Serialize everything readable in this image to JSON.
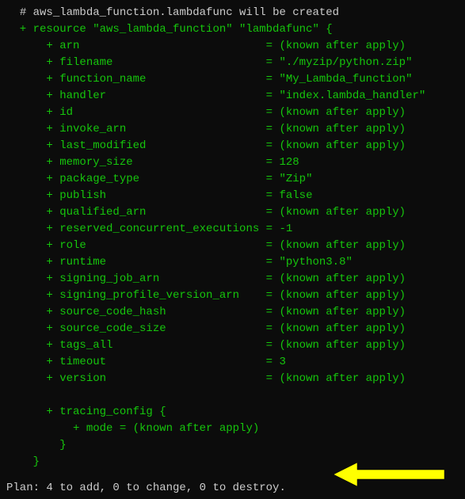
{
  "header_comment": "# aws_lambda_function.lambdafunc will be created",
  "resource_line": "  + resource \"aws_lambda_function\" \"lambdafunc\" {",
  "attrs": [
    {
      "key": "      + arn                            ",
      "val": "= (known after apply)"
    },
    {
      "key": "      + filename                       ",
      "val": "= \"./myzip/python.zip\""
    },
    {
      "key": "      + function_name                  ",
      "val": "= \"My_Lambda_function\""
    },
    {
      "key": "      + handler                        ",
      "val": "= \"index.lambda_handler\""
    },
    {
      "key": "      + id                             ",
      "val": "= (known after apply)"
    },
    {
      "key": "      + invoke_arn                     ",
      "val": "= (known after apply)"
    },
    {
      "key": "      + last_modified                  ",
      "val": "= (known after apply)"
    },
    {
      "key": "      + memory_size                    ",
      "val": "= 128"
    },
    {
      "key": "      + package_type                   ",
      "val": "= \"Zip\""
    },
    {
      "key": "      + publish                        ",
      "val": "= false"
    },
    {
      "key": "      + qualified_arn                  ",
      "val": "= (known after apply)"
    },
    {
      "key": "      + reserved_concurrent_executions ",
      "val": "= -1"
    },
    {
      "key": "      + role                           ",
      "val": "= (known after apply)"
    },
    {
      "key": "      + runtime                        ",
      "val": "= \"python3.8\""
    },
    {
      "key": "      + signing_job_arn                ",
      "val": "= (known after apply)"
    },
    {
      "key": "      + signing_profile_version_arn    ",
      "val": "= (known after apply)"
    },
    {
      "key": "      + source_code_hash               ",
      "val": "= (known after apply)"
    },
    {
      "key": "      + source_code_size               ",
      "val": "= (known after apply)"
    },
    {
      "key": "      + tags_all                       ",
      "val": "= (known after apply)"
    },
    {
      "key": "      + timeout                        ",
      "val": "= 3"
    },
    {
      "key": "      + version                        ",
      "val": "= (known after apply)"
    }
  ],
  "tracing_open": "      + tracing_config {",
  "tracing_mode": "          + mode = (known after apply)",
  "tracing_close": "        }",
  "resource_close": "    }",
  "plan": "Plan: 4 to add, 0 to change, 0 to destroy."
}
